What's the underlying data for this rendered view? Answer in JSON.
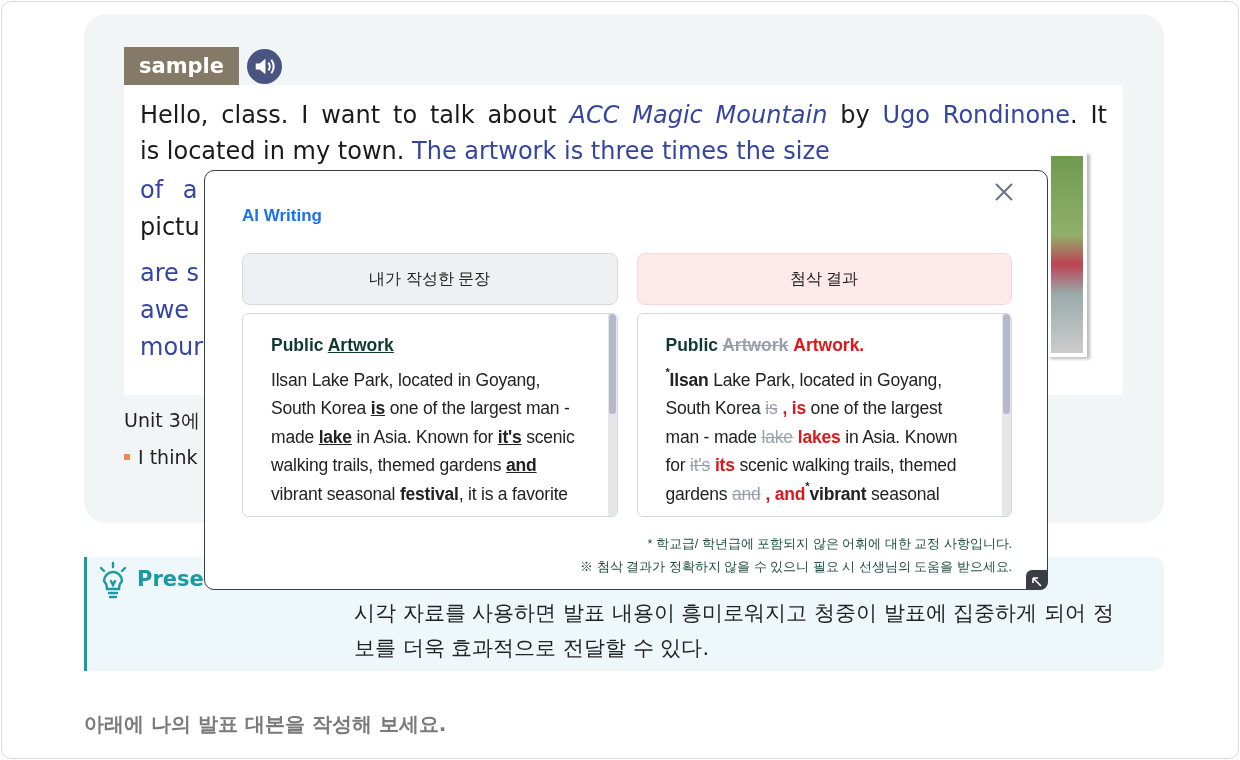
{
  "sample": {
    "tag": "sample",
    "lines": [
      [
        {
          "kind": "plain",
          "text": "Hello, class. I want to talk about "
        },
        {
          "kind": "title",
          "text": "ACC Magic Mountain"
        },
        {
          "kind": "plain",
          "text": " by "
        },
        {
          "kind": "link",
          "text": "Ugo Rondinone"
        },
        {
          "kind": "plain",
          "text": ". It"
        }
      ],
      [
        {
          "kind": "plain",
          "text": "is located in my town. "
        },
        {
          "kind": "link",
          "text": "The artwork is three times the size"
        }
      ]
    ],
    "fragments": [
      {
        "kind": "link",
        "text": "of a"
      },
      {
        "kind": "plain",
        "text": "pictu"
      },
      {
        "kind": "link",
        "text": "are s"
      },
      {
        "kind": "link",
        "text": "awe"
      },
      {
        "kind": "link",
        "text": "mour"
      }
    ],
    "unit_note": "Unit 3에",
    "bullet": "I think"
  },
  "presentation": {
    "heading": "Prese",
    "body": "시각 자료를 사용하면 발표 내용이 흥미로워지고 청중이 발표에 집중하게 되어 정보를 더욱 효과적으로 전달할 수 있다."
  },
  "instruction": "아래에 나의 발표 대본을 작성해 보세요.",
  "dialog": {
    "title": "AI Writing",
    "columns": [
      {
        "kind": "original",
        "header": "내가 작성한 문장",
        "heading": [
          {
            "kind": "plain",
            "text": "Public "
          },
          {
            "kind": "marked",
            "text": "Artwork"
          }
        ],
        "body": [
          {
            "kind": "plain",
            "text": "Ilsan Lake Park, located in Goyang, South Korea "
          },
          {
            "kind": "marked",
            "text": "is"
          },
          {
            "kind": "plain",
            "text": " one of the largest man - made "
          },
          {
            "kind": "marked",
            "text": "lake"
          },
          {
            "kind": "plain",
            "text": " in Asia. Known for "
          },
          {
            "kind": "marked",
            "text": "it's"
          },
          {
            "kind": "plain",
            "text": " scenic walking trails, themed gardens "
          },
          {
            "kind": "marked",
            "text": "and"
          },
          {
            "kind": "plain",
            "text": " vibrant seasonal "
          },
          {
            "kind": "bold",
            "text": "festival"
          },
          {
            "kind": "plain",
            "text": ", it is a favorite"
          }
        ]
      },
      {
        "kind": "corrected",
        "header": "첨삭 결과",
        "heading": [
          {
            "kind": "plain",
            "text": "Public "
          },
          {
            "kind": "deleted",
            "text": "Artwork"
          },
          {
            "kind": "added",
            "text": "Artwork."
          }
        ],
        "body": [
          {
            "kind": "note",
            "text": "*"
          },
          {
            "kind": "bold",
            "text": "Ilsan"
          },
          {
            "kind": "plain",
            "text": " Lake Park, located in Goyang, South Korea "
          },
          {
            "kind": "deleted",
            "text": "is"
          },
          {
            "kind": "added",
            "text": ", is"
          },
          {
            "kind": "plain",
            "text": " one of the largest man - made "
          },
          {
            "kind": "deleted",
            "text": "lake"
          },
          {
            "kind": "added",
            "text": "lakes"
          },
          {
            "kind": "plain",
            "text": " in Asia. Known for "
          },
          {
            "kind": "deleted",
            "text": "it's"
          },
          {
            "kind": "added",
            "text": "its"
          },
          {
            "kind": "plain",
            "text": " scenic walking trails, themed gardens "
          },
          {
            "kind": "deleted",
            "text": "and"
          },
          {
            "kind": "added",
            "text": ", and"
          },
          {
            "kind": "note",
            "text": "*"
          },
          {
            "kind": "bold",
            "text": "vibrant"
          },
          {
            "kind": "plain",
            "text": " seasonal"
          }
        ]
      }
    ],
    "notes": [
      "* 학교급/ 학년급에 포함되지 않은 어휘에 대한 교정 사항입니다.",
      "※ 첨삭 결과가 정확하지 않을 수 있으니 필요 시 선생님의 도움을 받으세요."
    ]
  }
}
